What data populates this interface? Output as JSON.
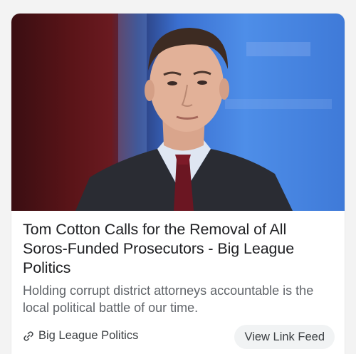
{
  "article": {
    "title": "Tom Cotton Calls for the Removal of All Soros-Funded Prosecutors - Big League Politics",
    "snippet": "Holding corrupt district attorneys accountable is the local political battle of our time.",
    "source": "Big League Politics",
    "action_label": "View Link Feed"
  },
  "icons": {
    "source": "link-icon"
  },
  "colors": {
    "title": "#202124",
    "snippet": "#5f6368",
    "button_bg": "#f1f3f4"
  }
}
